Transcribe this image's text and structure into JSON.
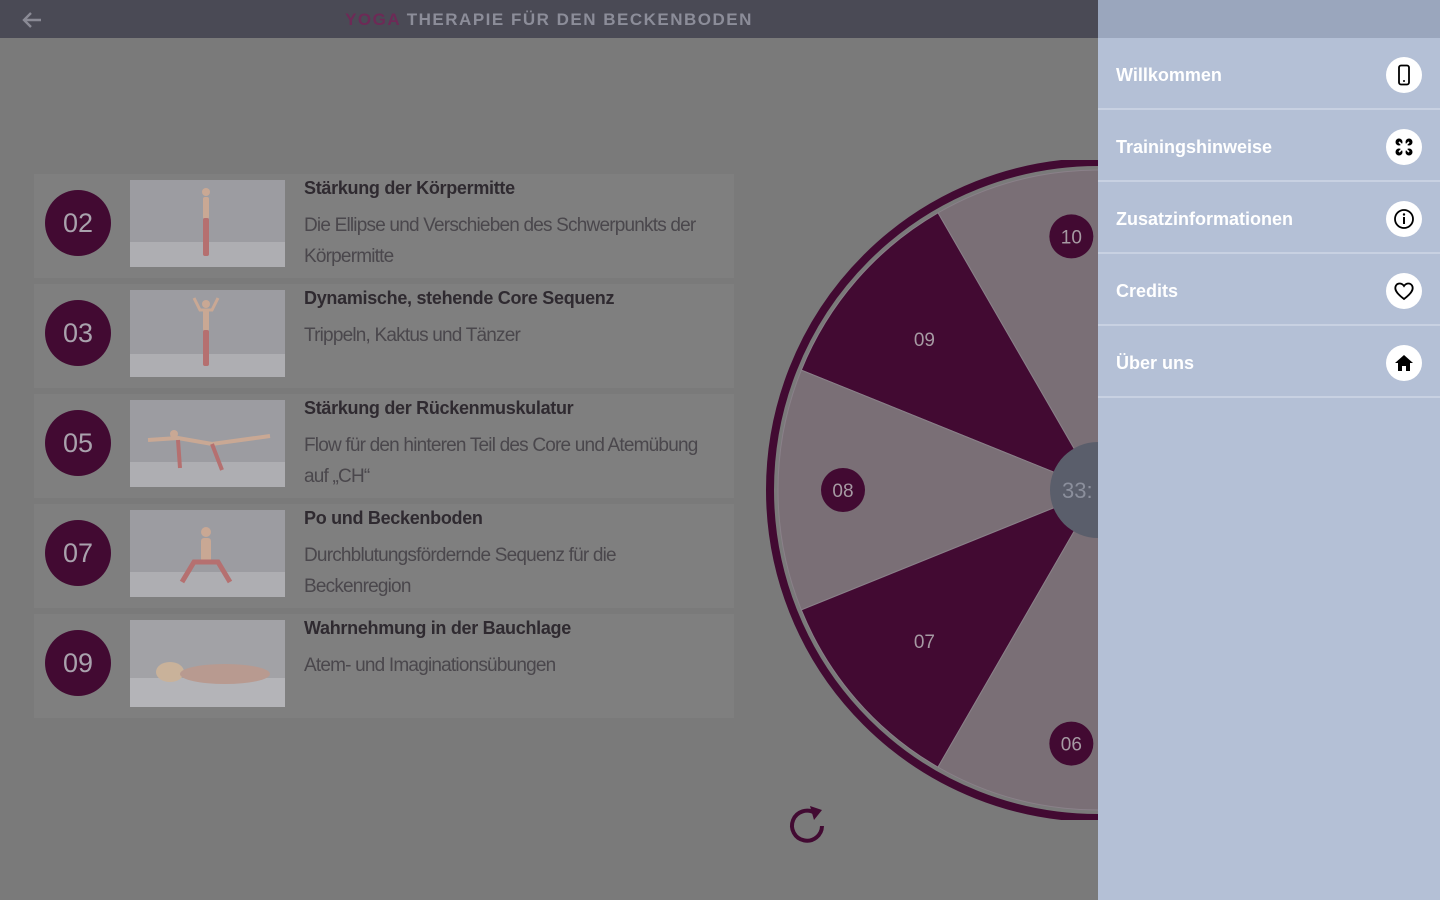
{
  "header": {
    "title_accent": "YOGA",
    "title_rest": "THERAPIE FÜR DEN BECKENBODEN"
  },
  "exercises": [
    {
      "number": "02",
      "title": "Stärkung der Körpermitte",
      "description": "Die Ellipse und Verschieben des Schwerpunkts der Körpermitte"
    },
    {
      "number": "03",
      "title": "Dynamische, stehende Core Sequenz",
      "description": "Trippeln, Kaktus und Tänzer"
    },
    {
      "number": "05",
      "title": "Stärkung der Rückenmuskulatur",
      "description": "Flow für den hinteren Teil des Core und Atemübung auf „CH“"
    },
    {
      "number": "07",
      "title": "Po und Beckenboden",
      "description": "Durchblutungsfördernde Sequenz für die Beckenregion"
    },
    {
      "number": "09",
      "title": "Wahrnehmung in der Bauchlage",
      "description": "Atem- und Imaginationsübungen"
    }
  ],
  "wheel": {
    "segments": [
      "10",
      "09",
      "08",
      "07",
      "06"
    ],
    "center_label": "33:",
    "colors": {
      "dark": "#420a32",
      "light": "#7a6f76",
      "rim": "#420a32",
      "center": "#5a5e6b"
    }
  },
  "drawer": {
    "items": [
      {
        "label": "Willkommen",
        "icon": "phone-icon"
      },
      {
        "label": "Trainingshinweise",
        "icon": "training-icon"
      },
      {
        "label": "Zusatzinformationen",
        "icon": "info-icon"
      },
      {
        "label": "Credits",
        "icon": "heart-icon"
      },
      {
        "label": "Über uns",
        "icon": "home-icon"
      }
    ]
  }
}
